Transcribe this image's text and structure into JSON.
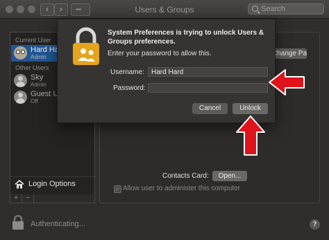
{
  "window": {
    "title": "Users & Groups"
  },
  "toolbar": {
    "back": "‹",
    "forward": "›",
    "grid": "▪▪▪▪"
  },
  "search": {
    "placeholder": "Search"
  },
  "sidebar": {
    "current_user_heading": "Current User",
    "other_users_heading": "Other Users",
    "users": [
      {
        "name": "Hard Hard",
        "role": "Admin"
      },
      {
        "name": "Sky",
        "role": "Admin"
      },
      {
        "name": "Guest User",
        "role": "Off"
      }
    ],
    "login_options_label": "Login Options",
    "add_label": "+",
    "remove_label": "−"
  },
  "content": {
    "change_password_label": "Change Password...",
    "contacts_card_label": "Contacts Card:",
    "open_label": "Open...",
    "allow_admin_label": "Allow user to administer this computer",
    "allow_admin_checkmark": "✓"
  },
  "footer": {
    "status": "Authenticating...",
    "help": "?"
  },
  "dialog": {
    "title": "System Preferences is trying to unlock Users & Groups preferences.",
    "message": "Enter your password to allow this.",
    "username_label": "Username:",
    "username_value": "Hard Hard",
    "password_label": "Password:",
    "password_value": "",
    "cancel_label": "Cancel",
    "unlock_label": "Unlock"
  },
  "colors": {
    "selection": "#215693",
    "annotation_arrow": "#e0121b",
    "lock_gold": "#e6a31c"
  }
}
